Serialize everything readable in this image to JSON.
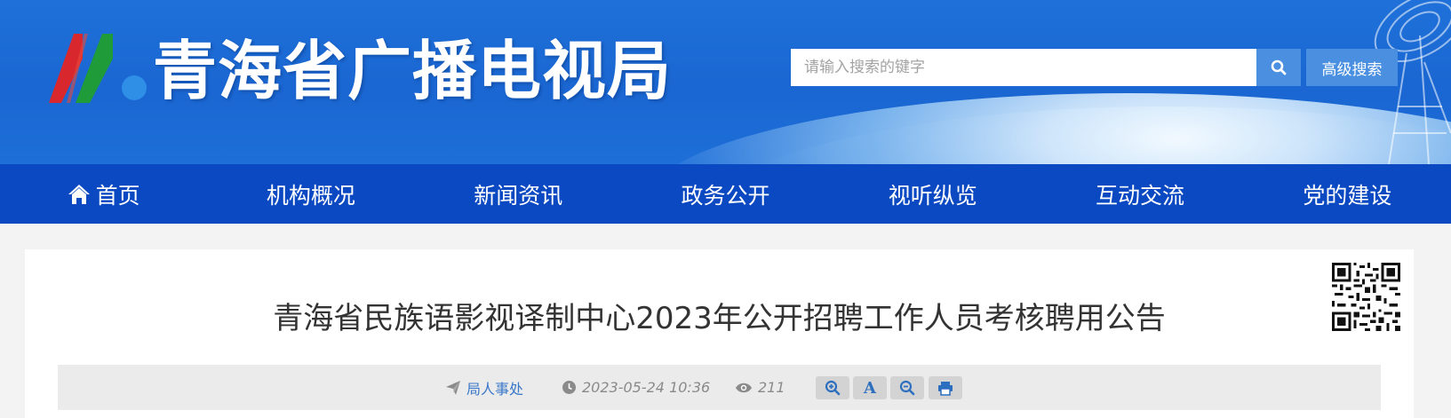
{
  "header": {
    "site_title": "青海省广播电视局",
    "search": {
      "placeholder": "请输入搜索的键字"
    },
    "advanced_search_label": "高级搜索"
  },
  "nav": {
    "items": [
      {
        "label": "首页",
        "icon": "home-icon"
      },
      {
        "label": "机构概况"
      },
      {
        "label": "新闻资讯"
      },
      {
        "label": "政务公开"
      },
      {
        "label": "视听纵览"
      },
      {
        "label": "互动交流"
      },
      {
        "label": "党的建设"
      }
    ]
  },
  "article": {
    "title": "青海省民族语影视译制中心2023年公开招聘工作人员考核聘用公告",
    "source": "局人事处",
    "date": "2023-05-24 10:36",
    "views": "211",
    "tools": {
      "zoom_in_icon": "zoom-in-icon",
      "font_label": "A",
      "zoom_out_icon": "zoom-out-icon",
      "print_icon": "print-icon"
    }
  },
  "colors": {
    "header_blue": "#1a66d2",
    "nav_blue": "#0a49c2",
    "button_blue": "#4a8fe0",
    "link_blue": "#3a78c9"
  }
}
